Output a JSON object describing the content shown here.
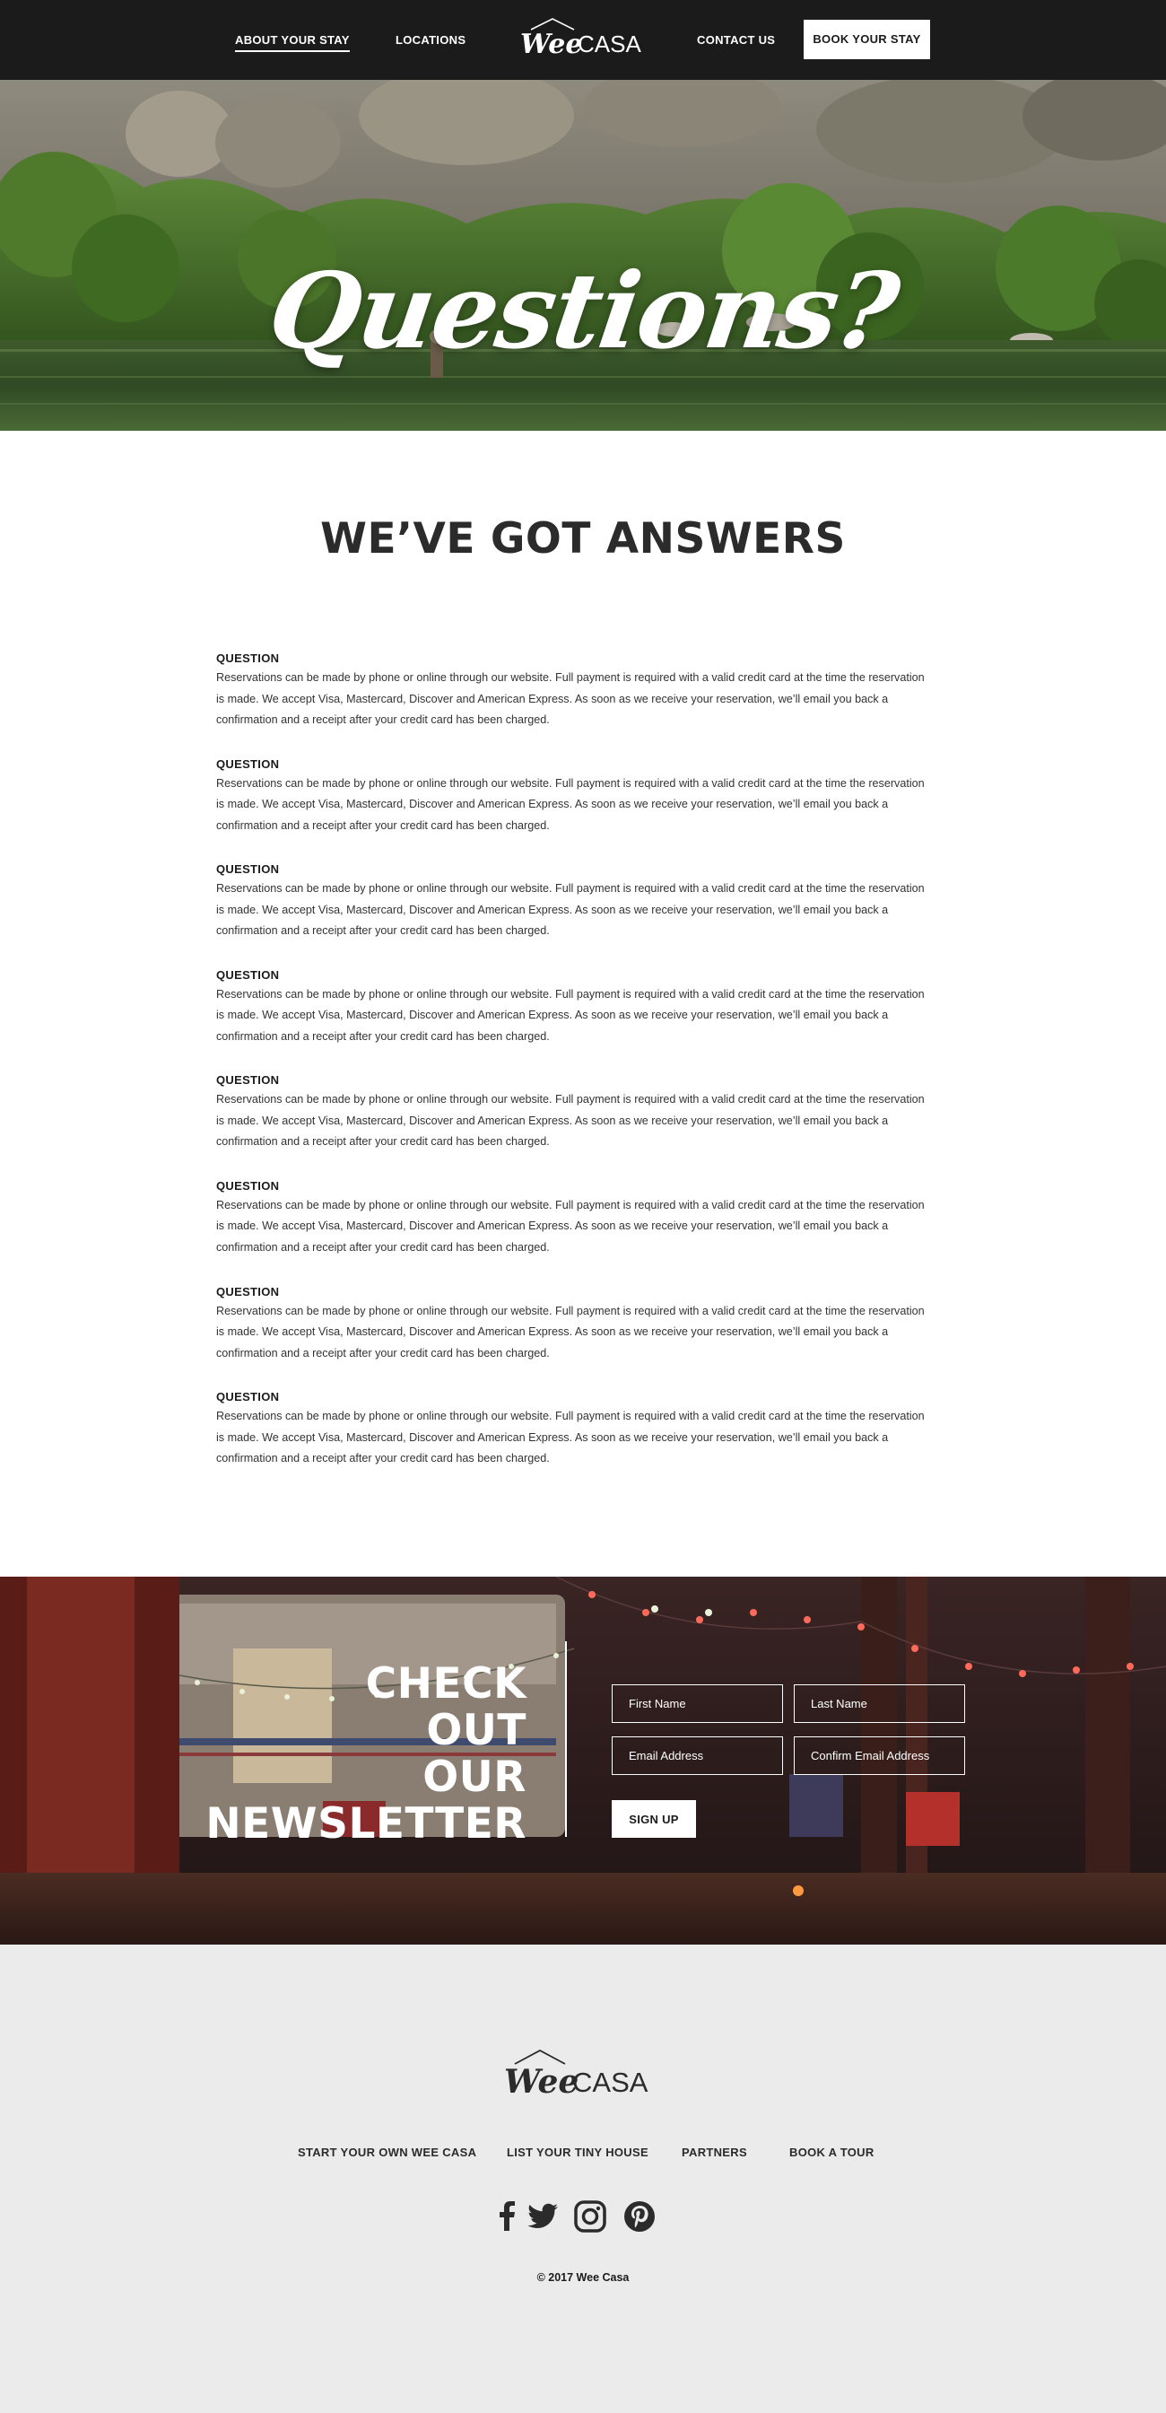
{
  "nav": {
    "about_label": "ABOUT YOUR STAY",
    "locations_label": "LOCATIONS",
    "contact_label": "CONTACT US",
    "book_label": "BOOK YOUR STAY",
    "logo_wee": "Wee",
    "logo_casa": "CASA"
  },
  "hero": {
    "title": "Questions?"
  },
  "faq": {
    "heading": "WE’VE GOT ANSWERS",
    "items": [
      {
        "question": "QUESTION",
        "answer": "Reservations can be made by phone or online through our website. Full payment is required with a valid credit card at the time the reservation is made. We accept Visa, Mastercard, Discover and American Express. As soon as we receive your reservation, we’ll email you back a confirmation and a receipt after your credit card has been charged."
      },
      {
        "question": "QUESTION",
        "answer": "Reservations can be made by phone or online through our website. Full payment is required with a valid credit card at the time the reservation is made. We accept Visa, Mastercard, Discover and American Express. As soon as we receive your reservation, we’ll email you back a confirmation and a receipt after your credit card has been charged."
      },
      {
        "question": "QUESTION",
        "answer": "Reservations can be made by phone or online through our website. Full payment is required with a valid credit card at the time the reservation is made. We accept Visa, Mastercard, Discover and American Express. As soon as we receive your reservation, we’ll email you back a confirmation and a receipt after your credit card has been charged."
      },
      {
        "question": "QUESTION",
        "answer": "Reservations can be made by phone or online through our website. Full payment is required with a valid credit card at the time the reservation is made. We accept Visa, Mastercard, Discover and American Express. As soon as we receive your reservation, we’ll email you back a confirmation and a receipt after your credit card has been charged."
      },
      {
        "question": "QUESTION",
        "answer": "Reservations can be made by phone or online through our website. Full payment is required with a valid credit card at the time the reservation is made. We accept Visa, Mastercard, Discover and American Express. As soon as we receive your reservation, we’ll email you back a confirmation and a receipt after your credit card has been charged."
      },
      {
        "question": "QUESTION",
        "answer": "Reservations can be made by phone or online through our website. Full payment is required with a valid credit card at the time the reservation is made. We accept Visa, Mastercard, Discover and American Express. As soon as we receive your reservation, we’ll email you back a confirmation and a receipt after your credit card has been charged."
      },
      {
        "question": "QUESTION",
        "answer": "Reservations can be made by phone or online through our website. Full payment is required with a valid credit card at the time the reservation is made. We accept Visa, Mastercard, Discover and American Express. As soon as we receive your reservation, we’ll email you back a confirmation and a receipt after your credit card has been charged."
      },
      {
        "question": "QUESTION",
        "answer": "Reservations can be made by phone or online through our website. Full payment is required with a valid credit card at the time the reservation is made. We accept Visa, Mastercard, Discover and American Express. As soon as we receive your reservation, we’ll email you back a confirmation and a receipt after your credit card has been charged."
      }
    ]
  },
  "newsletter": {
    "title_line1": "CHECK",
    "title_line2": "OUT",
    "title_line3": "OUR",
    "title_line4": "NEWSLETTER",
    "first_name_placeholder": "First Name",
    "last_name_placeholder": "Last Name",
    "email_placeholder": "Email Address",
    "confirm_email_placeholder": "Confirm Email Address",
    "submit_label": "SIGN UP"
  },
  "footer": {
    "logo_wee": "Wee",
    "logo_casa": "CASA",
    "links": [
      {
        "label": "START YOUR OWN WEE CASA"
      },
      {
        "label": "LIST YOUR TINY HOUSE"
      },
      {
        "label": "PARTNERS"
      },
      {
        "label": "BOOK A TOUR"
      }
    ],
    "social_icons": [
      "facebook-icon",
      "twitter-icon",
      "instagram-icon",
      "pinterest-icon"
    ],
    "copyright": "© 2017 Wee Casa"
  },
  "colors": {
    "nav_bg": "#1b1b1b",
    "text_dark": "#2b2b2b",
    "footer_bg": "#ebebeb",
    "accent_white": "#ffffff"
  }
}
